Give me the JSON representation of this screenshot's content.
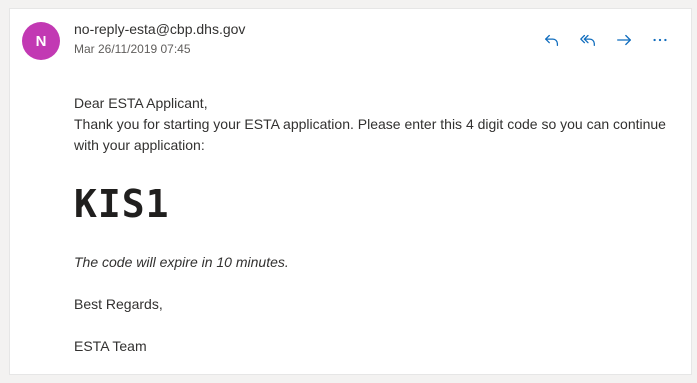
{
  "email": {
    "avatar_initial": "N",
    "avatar_color": "#c239b3",
    "sender": "no-reply-esta@cbp.dhs.gov",
    "date": "Mar 26/11/2019 07:45",
    "actions": [
      {
        "name": "reply",
        "icon": "reply-icon"
      },
      {
        "name": "reply-all",
        "icon": "reply-all-icon"
      },
      {
        "name": "forward",
        "icon": "forward-icon"
      },
      {
        "name": "more",
        "icon": "more-icon"
      }
    ],
    "accent_color": "#0f6cbd",
    "body": {
      "greeting": "Dear ESTA Applicant,",
      "line1": "Thank you for starting your ESTA application. Please enter this 4 digit code so you can continue with your application:",
      "code": "KIS1",
      "expiry": "The code will expire in 10 minutes.",
      "regards": "Best Regards,",
      "team": "ESTA Team"
    }
  }
}
